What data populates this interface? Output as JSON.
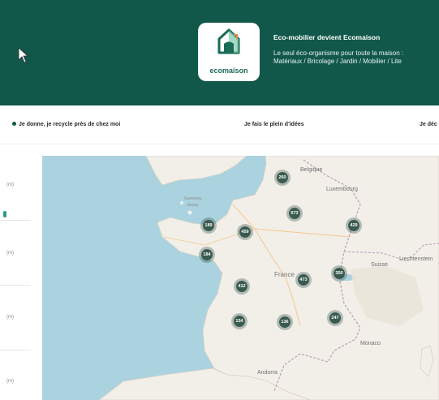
{
  "banner": {
    "logo_text": "ecomaison",
    "title": "Eco-mobilier devient Ecomaison",
    "subtitle_line1": "Le seul éco-organisme pour toute la maison :",
    "subtitle_line2": "Matériaux / Bricolage / Jardin / Mobilier / Lite",
    "colors": {
      "background": "#11584a",
      "text": "#ffffff"
    }
  },
  "nav": {
    "items": [
      "Je donne, je recycle près de chez moi",
      "Je fais le plein d'idées",
      "Je déc"
    ]
  },
  "sidebar": {
    "distance_labels": [
      "(m)",
      "(m)",
      "(m)",
      "(m)"
    ]
  },
  "map": {
    "labels": {
      "belgique": "Belgique",
      "luxembourg": "Luxembourg",
      "guernsey": "Guernsey",
      "jersey": "Jersey",
      "france": "France",
      "suisse": "Suisse",
      "liechtenstein": "Liechtenstein",
      "monaco": "Monaco",
      "andorra": "Andorra"
    },
    "clusters": [
      "260",
      "573",
      "429",
      "189",
      "459",
      "184",
      "473",
      "350",
      "412",
      "154",
      "136",
      "247"
    ],
    "colors": {
      "water": "#aad3df",
      "land": "#f2efe9",
      "cluster": "#3a5a50"
    }
  }
}
